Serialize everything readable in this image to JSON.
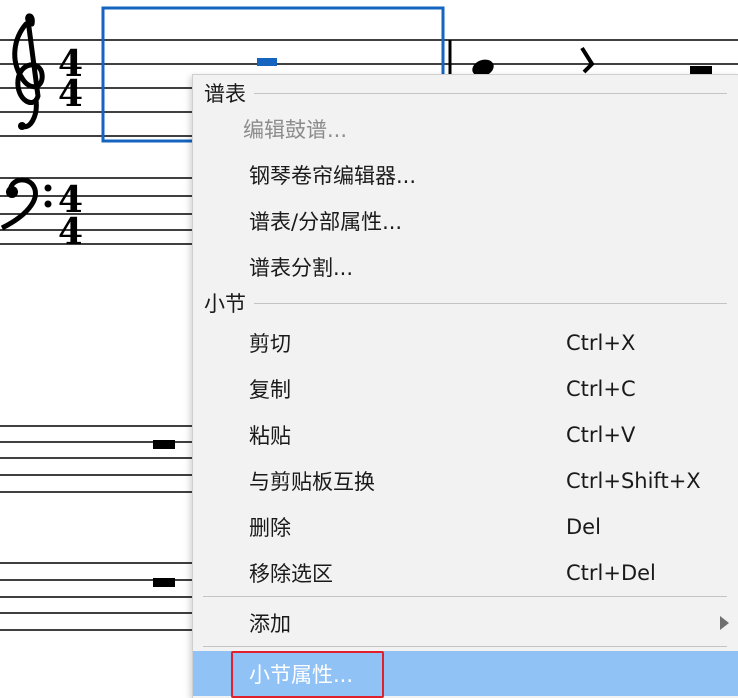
{
  "menu": {
    "sections": {
      "staff": {
        "title": "谱表",
        "items": [
          {
            "label": "编辑鼓谱...",
            "disabled": true
          },
          {
            "label": "钢琴卷帘编辑器..."
          },
          {
            "label": "谱表/分部属性..."
          },
          {
            "label": "谱表分割..."
          }
        ]
      },
      "measure": {
        "title": "小节",
        "items": [
          {
            "label": "剪切",
            "shortcut": "Ctrl+X"
          },
          {
            "label": "复制",
            "shortcut": "Ctrl+C"
          },
          {
            "label": "粘贴",
            "shortcut": "Ctrl+V"
          },
          {
            "label": "与剪贴板互换",
            "shortcut": "Ctrl+Shift+X"
          },
          {
            "label": "删除",
            "shortcut": "Del"
          },
          {
            "label": "移除选区",
            "shortcut": "Ctrl+Del"
          }
        ]
      }
    },
    "add": {
      "label": "添加"
    },
    "measure_properties": {
      "label": "小节属性..."
    }
  },
  "score": {
    "time_signature": "4/4",
    "selection_color": "#1565c0"
  },
  "colors": {
    "highlight": "#90c2f6",
    "annotation": "#e0202a"
  }
}
